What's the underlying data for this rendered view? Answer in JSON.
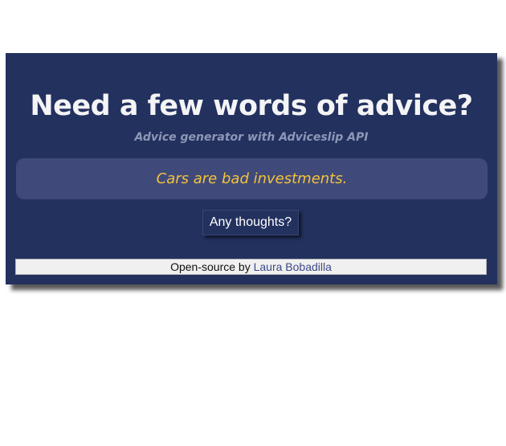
{
  "header": {
    "title": "Need a few words of advice?",
    "subtitle": "Advice generator with Adviceslip API"
  },
  "advice": {
    "text": "Cars are bad investments."
  },
  "actions": {
    "thoughts_button_label": "Any thoughts?"
  },
  "footer": {
    "prefix": "Open-source by ",
    "author_link_text": "Laura Bobadilla"
  },
  "colors": {
    "card_background": "#23315f",
    "advice_background": "#3f4a7a",
    "advice_text": "#f5c23a",
    "subtitle_text": "#8f97b7",
    "footer_background": "#f0f0f0",
    "link": "#3d4a87"
  }
}
